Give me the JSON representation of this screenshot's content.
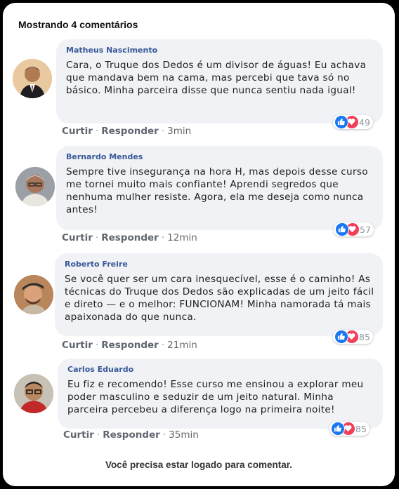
{
  "header": {
    "count_label": "Mostrando 4 comentários"
  },
  "actions": {
    "like": "Curtir",
    "reply": "Responder",
    "separator": "·"
  },
  "comments": [
    {
      "author": "Matheus Nascimento",
      "text": "Cara, o Truque dos Dedos é um divisor de águas! Eu achava que mandava bem na cama, mas percebi que tava só no básico. Minha parceira disse que nunca sentiu nada igual!",
      "time": "3min",
      "reactions": "49"
    },
    {
      "author": "Bernardo Mendes",
      "text": "Sempre tive insegurança na hora H, mas depois desse curso me tornei muito mais confiante! Aprendi segredos que nenhuma mulher resiste. Agora, ela me deseja como nunca antes!",
      "time": "12min",
      "reactions": "57"
    },
    {
      "author": "Roberto Freire",
      "text": "Se você quer ser um cara inesquecível, esse é o caminho! As técnicas do Truque dos Dedos são explicadas de um jeito fácil e direto — e o melhor: FUNCIONAM! Minha namorada tá mais apaixonada do que nunca.",
      "time": "21min",
      "reactions": "85"
    },
    {
      "author": "Carlos Eduardo",
      "text": "Eu fiz e recomendo! Esse curso me ensinou a explorar meu poder masculino e seduzir de um jeito natural. Minha parceira percebeu a diferença logo na primeira noite!",
      "time": "35min",
      "reactions": "85"
    }
  ],
  "footer": {
    "login_notice": "Você precisa estar logado para comentar."
  }
}
